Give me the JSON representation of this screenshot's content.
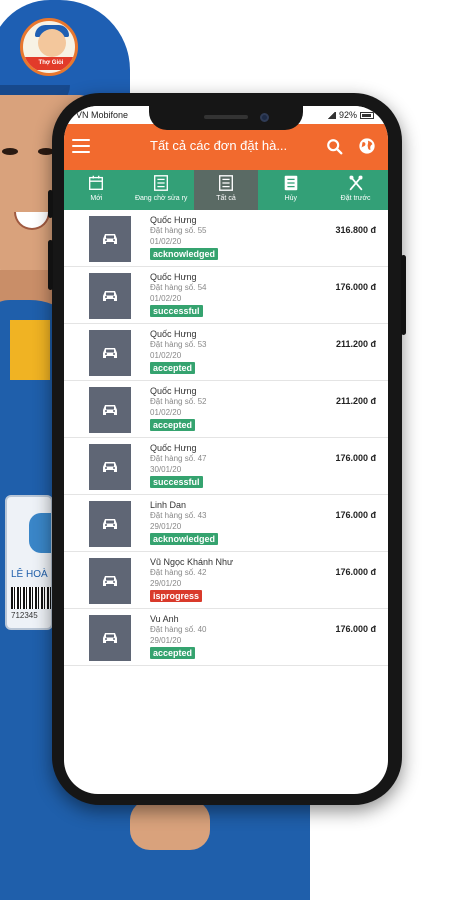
{
  "background": {
    "badge_text": "Thợ Giỏi",
    "id_card_name": "LÊ HOÀ",
    "id_card_number": "712345"
  },
  "status_bar": {
    "carrier": "VN Mobifone",
    "battery": "92%"
  },
  "app_bar": {
    "title": "Tất cả các đơn đặt hà...",
    "color": "#f26a2e"
  },
  "tabs": [
    {
      "label": "Mới",
      "icon": "calendar-icon",
      "active": false
    },
    {
      "label": "Đang chờ sửa ry",
      "icon": "list-icon",
      "active": false
    },
    {
      "label": "Tất cả",
      "icon": "list-icon",
      "active": true
    },
    {
      "label": "Hủy",
      "icon": "cancel-list-icon",
      "active": false
    },
    {
      "label": "Đặt trước",
      "icon": "fork-knife-icon",
      "active": false
    }
  ],
  "orders": [
    {
      "name": "Quốc Hưng",
      "order": "Đặt hàng số. 55",
      "date": "01/02/20",
      "status": "acknowledged",
      "price": "316.800 đ"
    },
    {
      "name": "Quốc Hưng",
      "order": "Đặt hàng số. 54",
      "date": "01/02/20",
      "status": "successful",
      "price": "176.000 đ"
    },
    {
      "name": "Quốc Hưng",
      "order": "Đặt hàng số. 53",
      "date": "01/02/20",
      "status": "accepted",
      "price": "211.200 đ"
    },
    {
      "name": "Quốc Hưng",
      "order": "Đặt hàng số. 52",
      "date": "01/02/20",
      "status": "accepted",
      "price": "211.200 đ"
    },
    {
      "name": "Quốc Hưng",
      "order": "Đặt hàng số. 47",
      "date": "30/01/20",
      "status": "successful",
      "price": "176.000 đ"
    },
    {
      "name": "Linh Dan",
      "order": "Đặt hàng số. 43",
      "date": "29/01/20",
      "status": "acknowledged",
      "price": "176.000 đ"
    },
    {
      "name": "Vũ Ngọc Khánh Như",
      "order": "Đặt hàng số. 42",
      "date": "29/01/20",
      "status": "isprogress",
      "price": "176.000 đ"
    },
    {
      "name": "Vu Anh",
      "order": "Đặt hàng số. 40",
      "date": "29/01/20",
      "status": "accepted",
      "price": "176.000 đ"
    }
  ],
  "status_colors": {
    "acknowledged": "#35a36f",
    "successful": "#35a36f",
    "accepted": "#35a36f",
    "isprogress": "#d93a2b"
  }
}
